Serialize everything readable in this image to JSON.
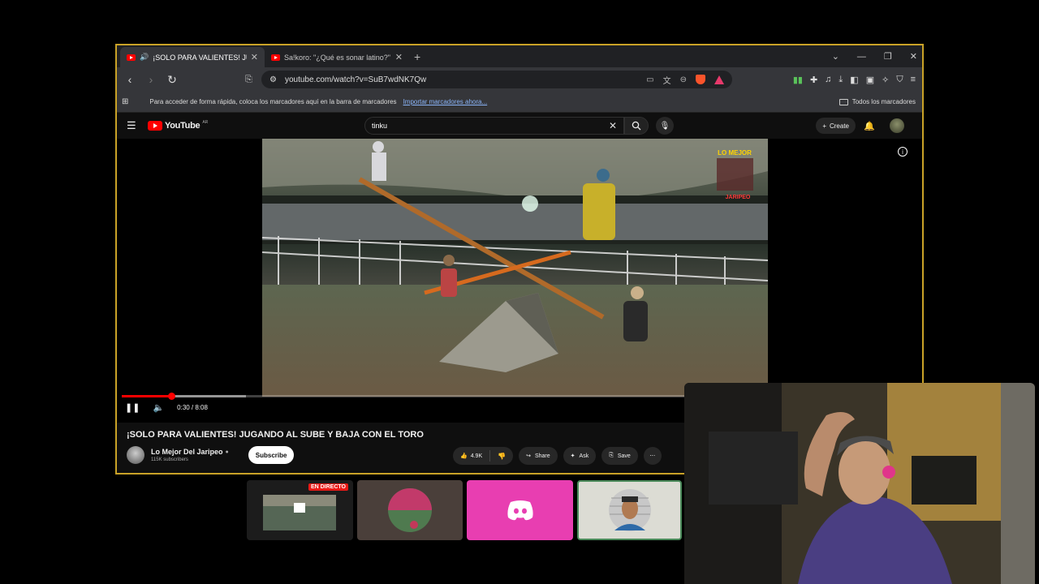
{
  "browser": {
    "tabs": [
      {
        "title": "¡SOLO PARA VALIENTES! JUGA",
        "active": true
      },
      {
        "title": "Sa!koro: \"¿Qué es sonar latino?\" | Ent",
        "active": false
      }
    ],
    "url": "youtube.com/watch?v=SuB7wdNK7Qw",
    "bookmarks_bar": {
      "hint": "Para acceder de forma rápida, coloca los marcadores aquí en la barra de marcadores",
      "import_link": "Importar marcadores ahora...",
      "all_bookmarks": "Todos los marcadores"
    }
  },
  "youtube": {
    "logo": "YouTube",
    "region": "AR",
    "search_value": "tinku",
    "create_label": "Create",
    "player": {
      "current_time": "0:30",
      "duration": "8:08",
      "time_display": "0:30 / 8:08",
      "played_fraction": 0.062,
      "buffered_fraction": 0.156,
      "video_watermark": "LO MEJOR DEL JARIPEO"
    },
    "video_title": "¡SOLO PARA VALIENTES! JUGANDO AL SUBE Y BAJA CON EL TORO",
    "channel": {
      "name": "Lo Mejor Del Jaripeo",
      "subscribers": "115K subscribers",
      "subscribe_label": "Subscribe"
    },
    "actions": {
      "likes": "4.9K",
      "share": "Share",
      "ask": "Ask",
      "save": "Save"
    }
  },
  "overlay": {
    "live_badge": "EN DIRECTO",
    "discord_color": "#e83eb1"
  }
}
